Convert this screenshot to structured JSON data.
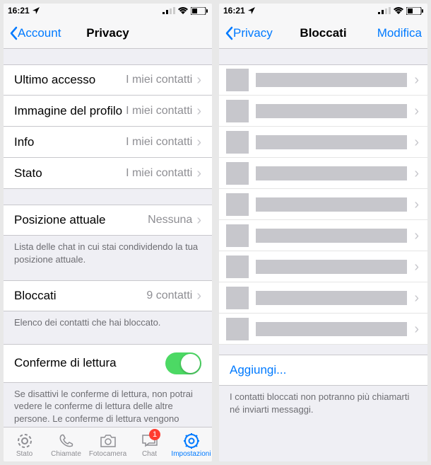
{
  "status": {
    "time": "16:21",
    "location_icon": "location-arrow",
    "signal": 2,
    "wifi": true,
    "battery": 40
  },
  "left_screen": {
    "nav": {
      "back": "Account",
      "title": "Privacy"
    },
    "privacy_rows": [
      {
        "label": "Ultimo accesso",
        "value": "I miei contatti"
      },
      {
        "label": "Immagine del profilo",
        "value": "I miei contatti"
      },
      {
        "label": "Info",
        "value": "I miei contatti"
      },
      {
        "label": "Stato",
        "value": "I miei contatti"
      }
    ],
    "live_location": {
      "label": "Posizione attuale",
      "value": "Nessuna"
    },
    "live_location_footer": "Lista delle chat in cui stai condividendo la tua posizione attuale.",
    "blocked": {
      "label": "Bloccati",
      "value": "9 contatti"
    },
    "blocked_footer": "Elenco dei contatti che hai bloccato.",
    "read_receipts": {
      "label": "Conferme di lettura",
      "on": true
    },
    "read_receipts_footer": "Se disattivi le conferme di lettura, non potrai vedere le conferme di lettura delle altre persone. Le conferme di lettura vengono sempre inviate per le chat di gruppo.",
    "tabs": {
      "state": "Stato",
      "calls": "Chiamate",
      "camera": "Fotocamera",
      "chats": "Chat",
      "settings": "Impostazioni",
      "chat_badge": "1"
    }
  },
  "right_screen": {
    "nav": {
      "back": "Privacy",
      "title": "Bloccati",
      "right": "Modifica"
    },
    "blocked_contacts": [
      {},
      {},
      {},
      {},
      {},
      {},
      {},
      {},
      {}
    ],
    "add_label": "Aggiungi...",
    "footer": "I contatti bloccati non potranno più chiamarti né inviarti messaggi."
  }
}
